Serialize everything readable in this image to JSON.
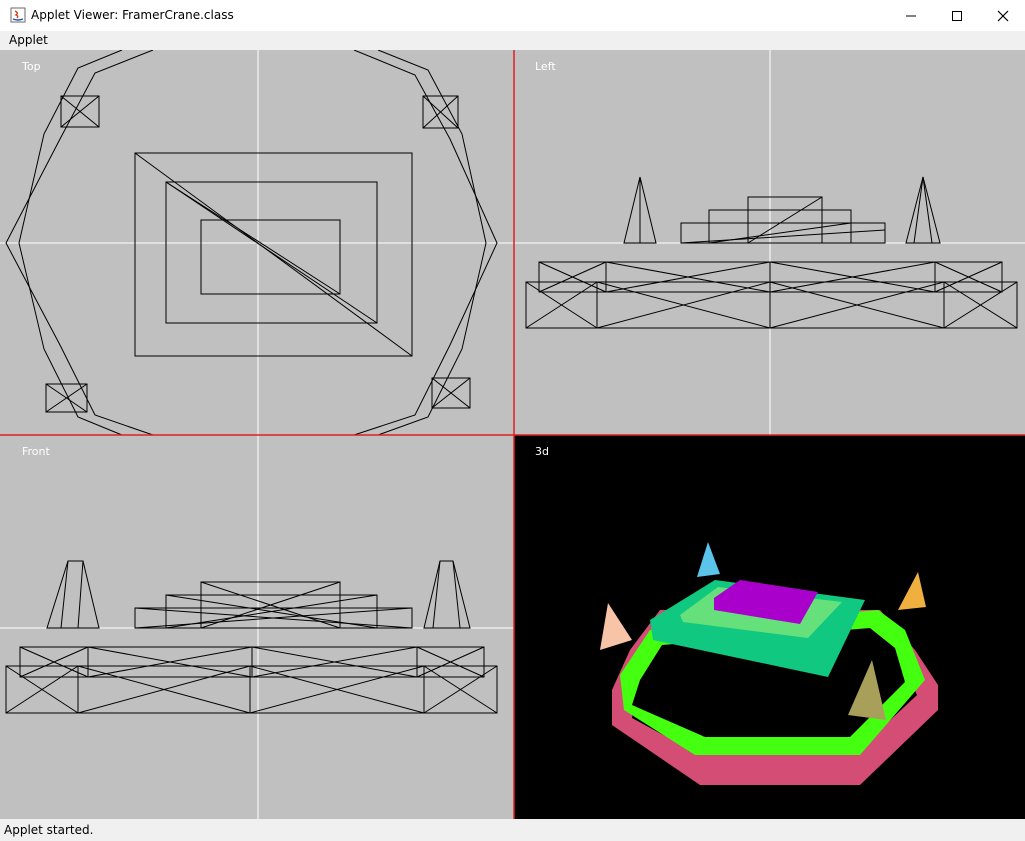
{
  "window": {
    "title": "Applet Viewer: FramerCrane.class",
    "controls": [
      "minimize-icon",
      "maximize-icon",
      "close-icon"
    ]
  },
  "menu": {
    "items": [
      "Applet"
    ]
  },
  "viewports": {
    "top": "Top",
    "left": "Left",
    "front": "Front",
    "persp": "3d"
  },
  "colors": {
    "viewport_bg": "#c0c0c0",
    "view3d_bg": "#000000",
    "divider": "#e02020",
    "axis": "#ffffff",
    "wire": "#000000"
  },
  "status": {
    "text": "Applet started."
  }
}
